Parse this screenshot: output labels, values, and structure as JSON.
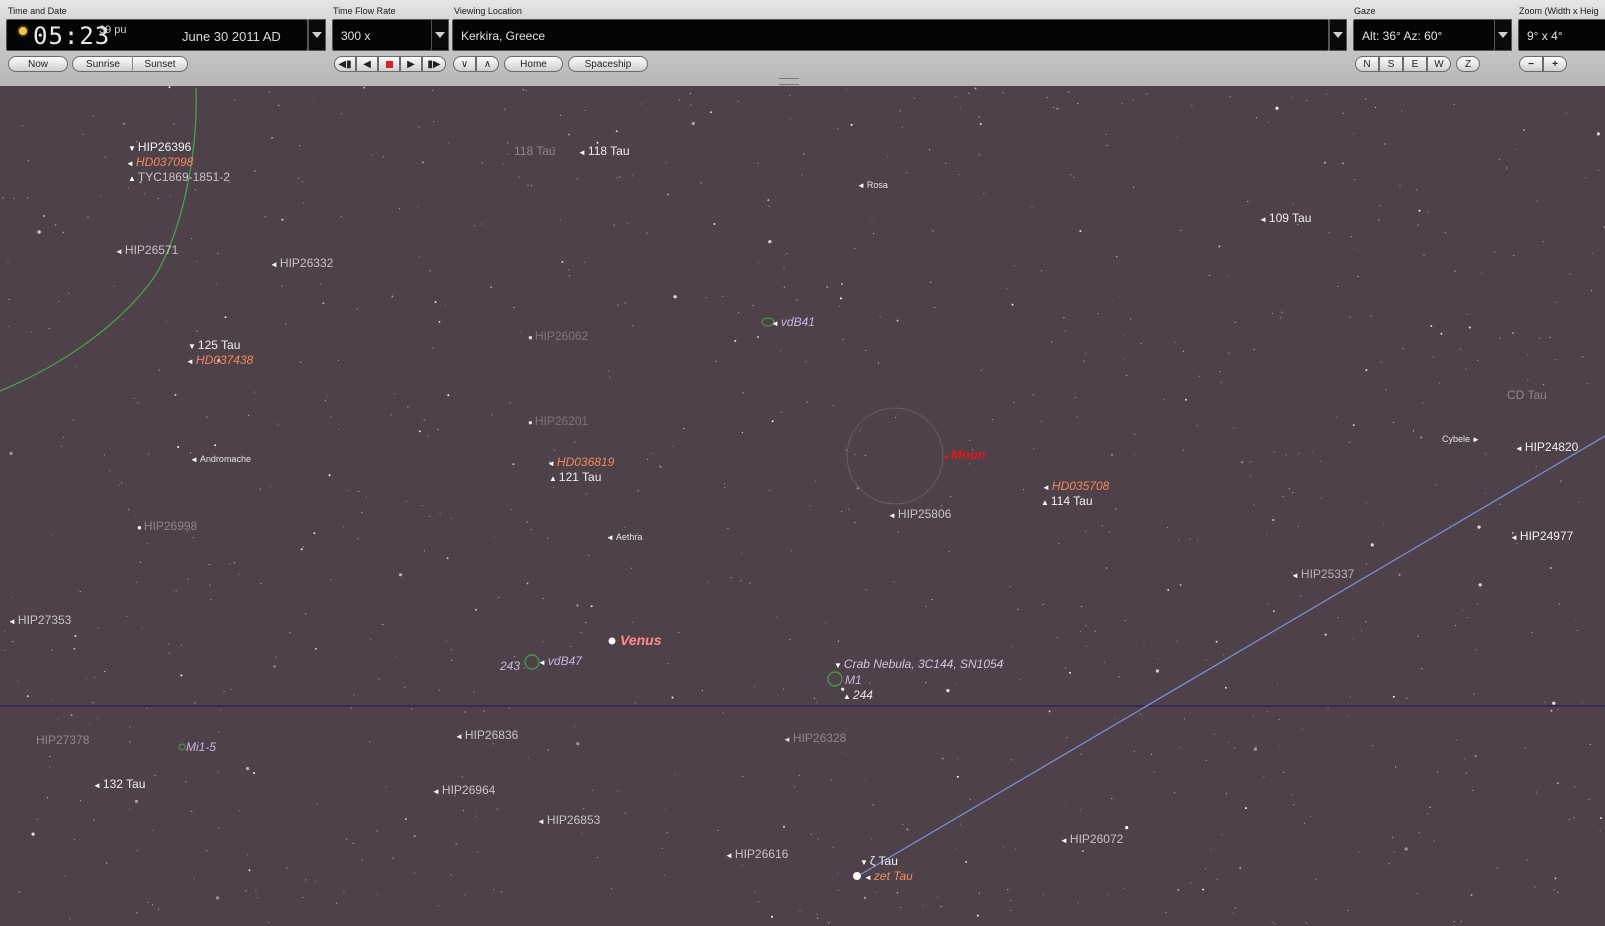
{
  "toolbar": {
    "time_date": {
      "label": "Time and Date",
      "clock": "05:23",
      "seconds": "39 pu",
      "date": "June 30   2011 AD",
      "buttons": {
        "now": "Now",
        "sunrise": "Sunrise",
        "sunset": "Sunset"
      }
    },
    "time_flow": {
      "label": "Time Flow Rate",
      "value": "300 x"
    },
    "location": {
      "label": "Viewing Location",
      "value": "Kerkira, Greece",
      "buttons": {
        "home": "Home",
        "spaceship": "Spaceship"
      }
    },
    "gaze": {
      "label": "Gaze",
      "value": "Alt: 36° Az: 60°",
      "directions": [
        "N",
        "S",
        "E",
        "W",
        "Z"
      ]
    },
    "zoom": {
      "label": "Zoom (Width x Heig",
      "value": "9° x 4°",
      "minus": "−",
      "plus": "+"
    }
  },
  "colors": {
    "sky": "#4f4149",
    "horizon_line": "#2c2460",
    "ecliptic": "#7a93d8",
    "milky_way": "#46a24a",
    "moon_label": "#e01818",
    "venus_label": "#ff8d85",
    "hd_label": "#f08a5a",
    "nebula_label": "#c9b5e0"
  },
  "sky_labels": {
    "hip26396": "HIP26396",
    "hd037098": "HD037098",
    "tyc": "TYC1869-1851-2",
    "hip26571": "HIP26571",
    "hip26332": "HIP26332",
    "tau125": "125 Tau",
    "hd037438": "HD037438",
    "andromache": "Andromache",
    "hip26998": "HIP26998",
    "hip27353": "HIP27353",
    "hip27378": "HIP27378",
    "mi15": "Mi1-5",
    "tau132": "132 Tau",
    "tau118a": "118 Tau",
    "tau118b": "118 Tau",
    "rosa": "Rosa",
    "vdb41": "vdB41",
    "hip26062": "HIP26062",
    "hip26201": "HIP26201",
    "hd036819": "HD036819",
    "tau121": "121 Tau",
    "aethra": "Aethra",
    "venus": "Venus",
    "vdb47": "vdB47",
    "n243": "243",
    "hip26836": "HIP26836",
    "hip26964": "HIP26964",
    "hip26853": "HIP26853",
    "hip26616": "HIP26616",
    "crab": "Crab Nebula, 3C144, SN1054",
    "m1": "M1",
    "n244": "244",
    "hip26328": "HIP26328",
    "moon": "Moon",
    "hd035708": "HD035708",
    "tau114": "114 Tau",
    "hip25806": "HIP25806",
    "hip26072": "HIP26072",
    "zeta_tau": "ζ Tau",
    "zet_tau": "zet  Tau",
    "tau109": "109 Tau",
    "cd_tau": "CD Tau",
    "cybele": "Cybele",
    "hip24820": "HIP24820",
    "hip24977": "HIP24977",
    "hip25337": "HIP25337"
  }
}
